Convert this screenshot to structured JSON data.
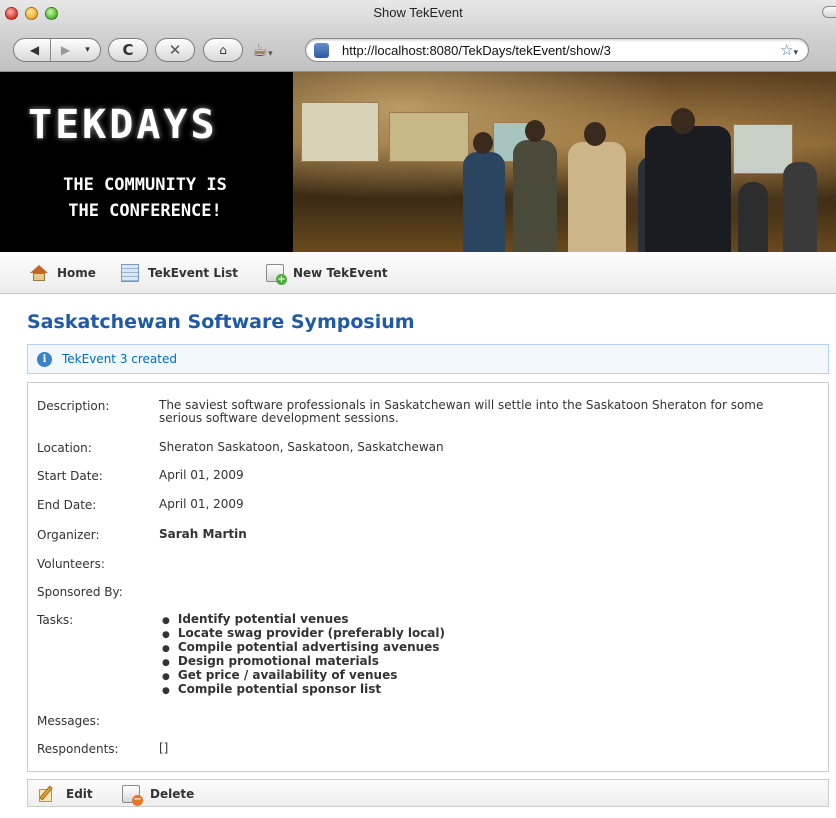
{
  "window": {
    "title": "Show TekEvent",
    "back_icon": "back-arrow-icon",
    "forward_icon": "forward-arrow-icon",
    "reload_icon": "reload-icon",
    "stop_icon": "stop-icon",
    "home_icon": "home-icon",
    "url": "http://localhost:8080/TekDays/tekEvent/show/3"
  },
  "banner": {
    "logo": "TEKDAYS",
    "tagline_line1": "THE COMMUNITY IS",
    "tagline_line2": "THE CONFERENCE!"
  },
  "nav": {
    "home": "Home",
    "list": "TekEvent List",
    "create": "New TekEvent"
  },
  "page": {
    "heading": "Saskatchewan Software Symposium",
    "message": "TekEvent 3 created"
  },
  "details": {
    "description_label": "Description:",
    "description": "The saviest software professionals in Saskatchewan will settle into the Saskatoon Sheraton for some serious software development sessions.",
    "location_label": "Location:",
    "location": "Sheraton Saskatoon, Saskatoon, Saskatchewan",
    "start_date_label": "Start Date:",
    "start_date": "April 01, 2009",
    "end_date_label": "End Date:",
    "end_date": "April 01, 2009",
    "organizer_label": "Organizer:",
    "organizer": "Sarah Martin",
    "volunteers_label": "Volunteers:",
    "sponsored_by_label": "Sponsored By:",
    "tasks_label": "Tasks:",
    "tasks": [
      "Identify potential venues",
      "Locate swag provider (preferably local)",
      "Compile potential advertising avenues",
      "Design promotional materials",
      "Get price / availability of venues",
      "Compile potential sponsor list"
    ],
    "messages_label": "Messages:",
    "respondents_label": "Respondents:",
    "respondents": "[]"
  },
  "actions": {
    "edit": "Edit",
    "delete": "Delete"
  }
}
